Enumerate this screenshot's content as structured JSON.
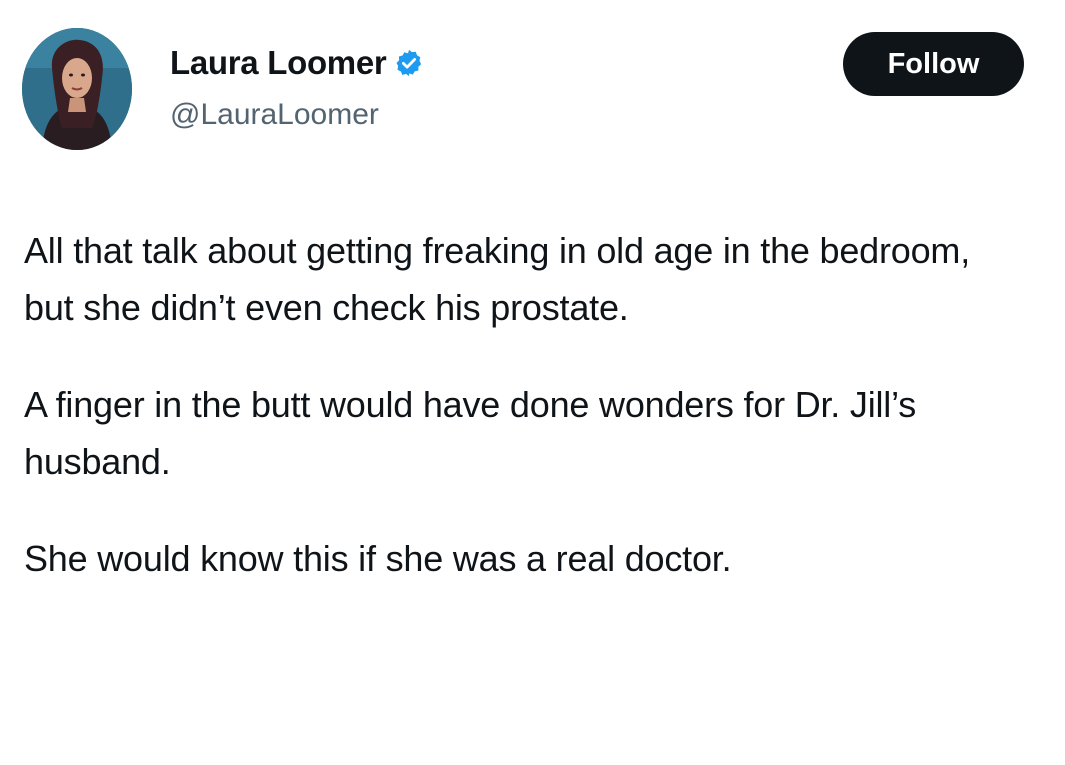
{
  "author": {
    "display_name": "Laura Loomer",
    "handle": "@LauraLoomer",
    "verified": true,
    "avatar_icon": "profile-photo"
  },
  "actions": {
    "follow_label": "Follow"
  },
  "tweet": {
    "paragraphs": [
      "All that talk about getting freaking in old age in the bedroom, but she didn’t even check his prostate.",
      "A finger in the butt would have done wonders for Dr. Jill’s husband.",
      "She would know this if she was a real doctor."
    ]
  },
  "colors": {
    "text": "#0f1419",
    "handle": "#536471",
    "button_bg": "#0f1419",
    "button_text": "#ffffff",
    "verified_badge": "#1d9bf0"
  }
}
